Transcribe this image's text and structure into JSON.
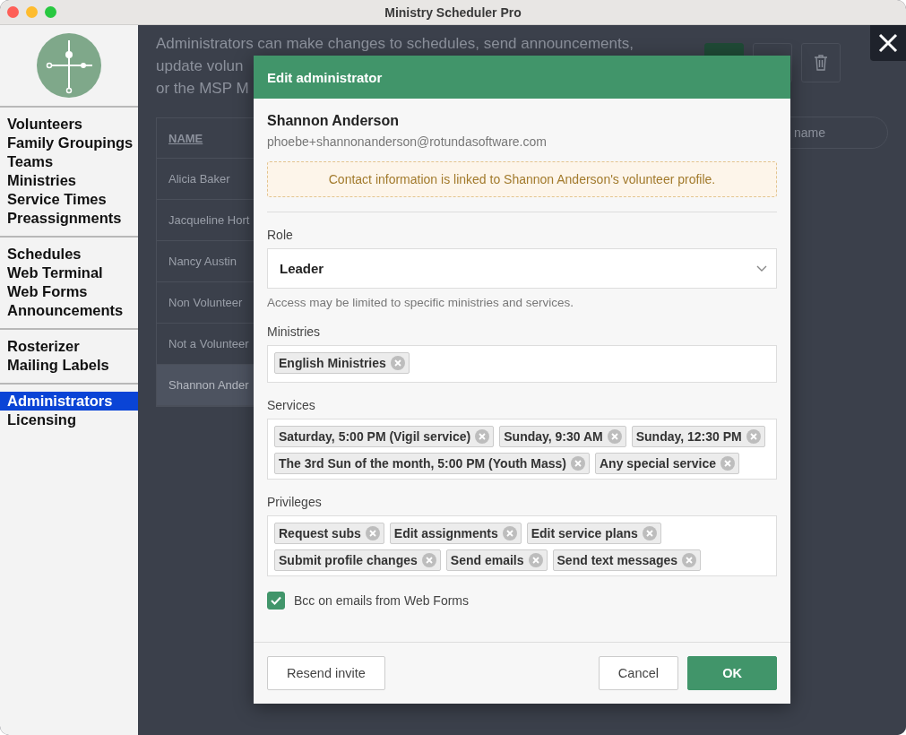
{
  "window": {
    "title": "Ministry Scheduler Pro"
  },
  "sidebar": {
    "groups": [
      [
        {
          "label": "Volunteers",
          "selected": false
        },
        {
          "label": "Family Groupings",
          "selected": false
        },
        {
          "label": "Teams",
          "selected": false
        },
        {
          "label": "Ministries",
          "selected": false
        },
        {
          "label": "Service Times",
          "selected": false
        },
        {
          "label": "Preassignments",
          "selected": false
        }
      ],
      [
        {
          "label": "Schedules",
          "selected": false
        },
        {
          "label": "Web Terminal",
          "selected": false
        },
        {
          "label": "Web Forms",
          "selected": false
        },
        {
          "label": "Announcements",
          "selected": false
        }
      ],
      [
        {
          "label": "Rosterizer",
          "selected": false
        },
        {
          "label": "Mailing Labels",
          "selected": false
        }
      ],
      [
        {
          "label": "Administrators",
          "selected": true
        },
        {
          "label": "Licensing",
          "selected": false
        }
      ]
    ]
  },
  "background": {
    "intro": [
      "Administrators can make changes to schedules, send announcements,",
      "update volun",
      "or the MSP M"
    ],
    "table": {
      "columns": [
        "NAME"
      ],
      "rows": [
        {
          "name": "Alicia Baker",
          "selected": false
        },
        {
          "name": "Jacqueline Hort",
          "selected": false
        },
        {
          "name": "Nancy Austin",
          "selected": false
        },
        {
          "name": "Non Volunteer",
          "selected": false
        },
        {
          "name": "Not a Volunteer",
          "selected": false
        },
        {
          "name": "Shannon Ander",
          "selected": true
        }
      ]
    },
    "search": {
      "placeholder": "name"
    }
  },
  "dialog": {
    "title": "Edit administrator",
    "name": "Shannon Anderson",
    "email": "phoebe+shannonanderson@rotundasoftware.com",
    "notice": "Contact information is linked to Shannon Anderson's volunteer profile.",
    "role": {
      "label": "Role",
      "value": "Leader",
      "help": "Access may be limited to specific ministries and services."
    },
    "ministries": {
      "label": "Ministries",
      "tags": [
        "English Ministries"
      ]
    },
    "services": {
      "label": "Services",
      "tags": [
        "Saturday, 5:00 PM (Vigil service)",
        "Sunday, 9:30 AM",
        "Sunday, 12:30 PM",
        "The 3rd Sun of the month, 5:00 PM (Youth Mass)",
        "Any special service"
      ]
    },
    "privileges": {
      "label": "Privileges",
      "tags": [
        "Request subs",
        "Edit assignments",
        "Edit service plans",
        "Submit profile changes",
        "Send emails",
        "Send text messages"
      ]
    },
    "bcc": {
      "label": "Bcc on emails from Web Forms",
      "checked": true
    },
    "buttons": {
      "secondary": "Resend invite",
      "cancel": "Cancel",
      "ok": "OK"
    }
  }
}
